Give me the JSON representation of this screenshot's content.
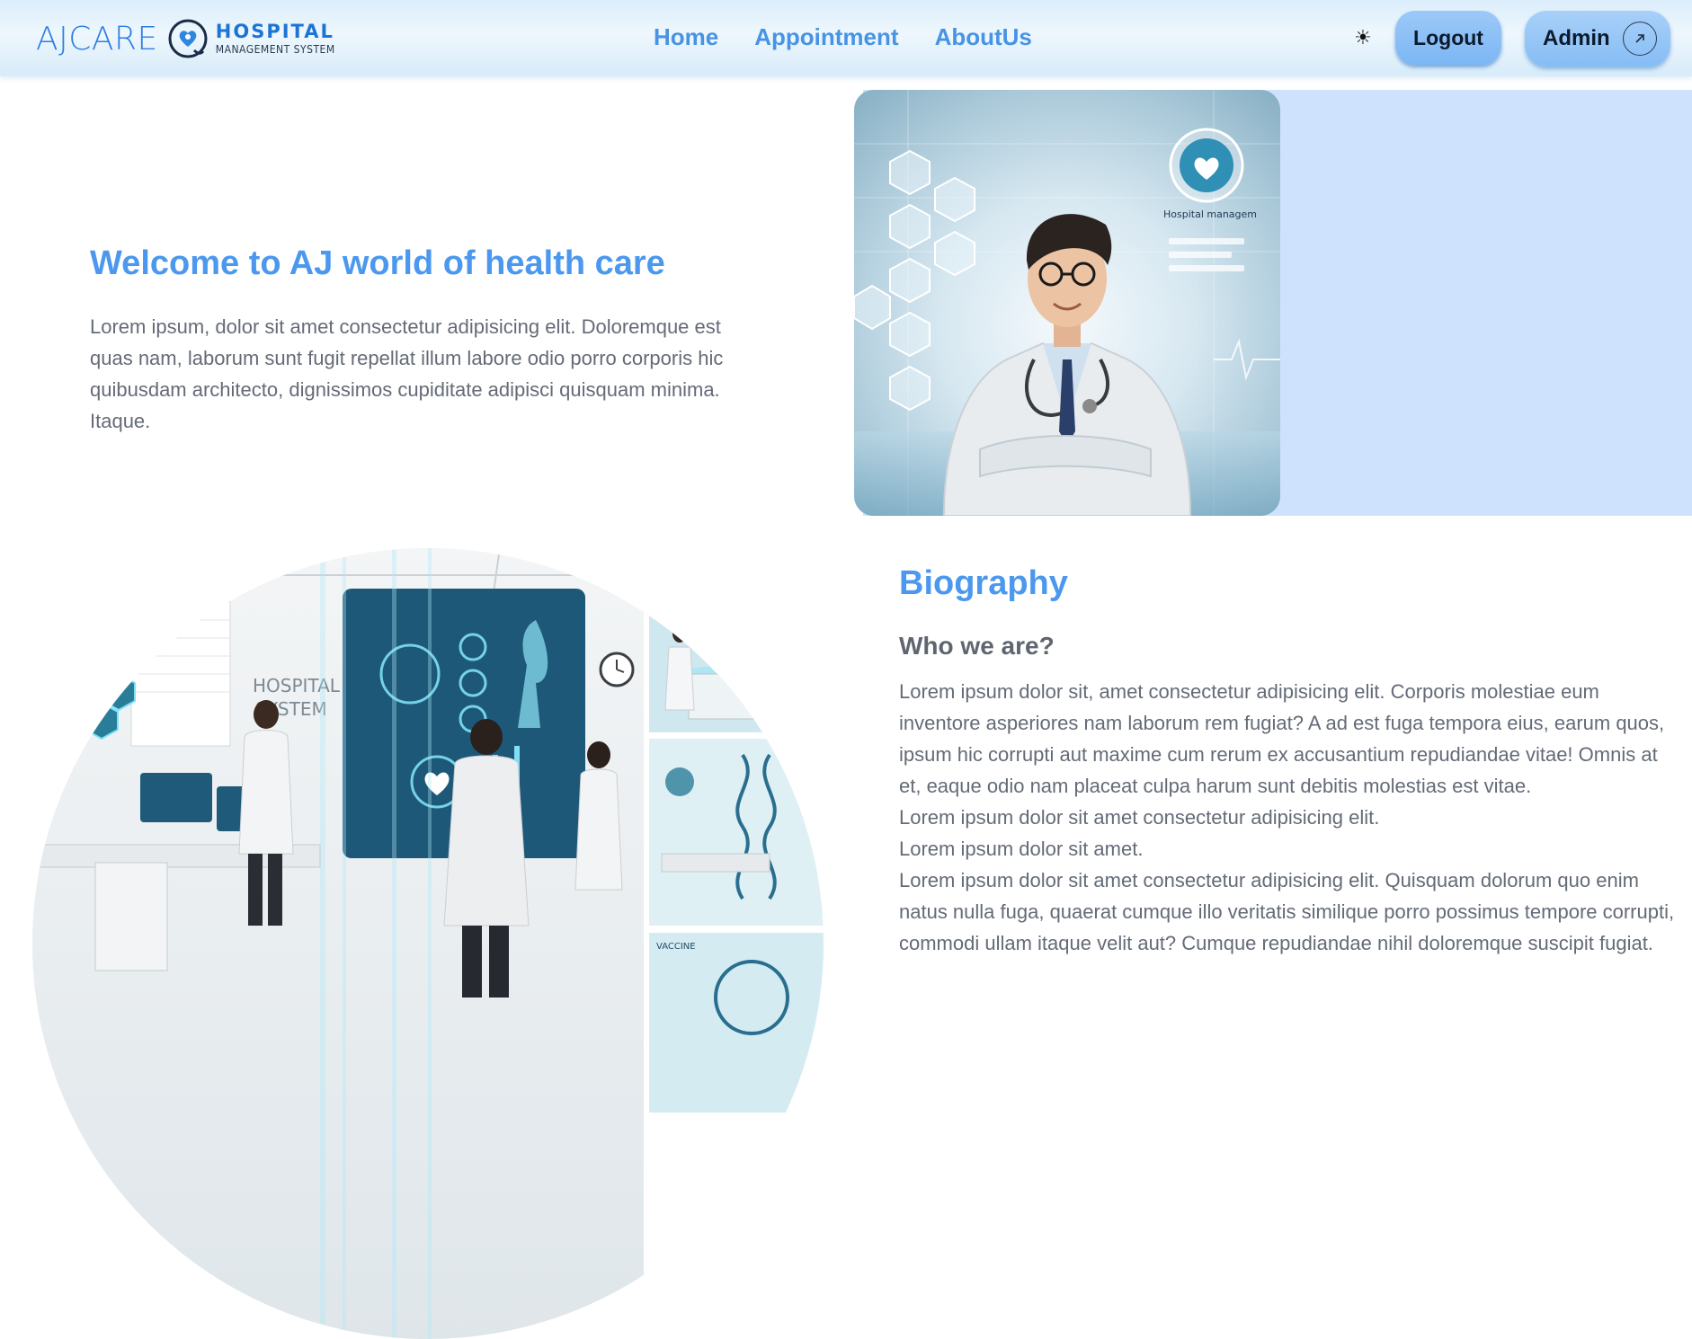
{
  "brand": {
    "name": "AJCARE",
    "sub_line_1": "HOSPITAL",
    "sub_line_2": "MANAGEMENT SYSTEM"
  },
  "nav": {
    "links": [
      "Home",
      "Appointment",
      "AboutUs"
    ],
    "theme_icon": "sun-icon",
    "logout_label": "Logout",
    "admin_label": "Admin",
    "admin_icon": "arrow-up-right-icon"
  },
  "hero": {
    "title": "Welcome to AJ world of health care",
    "text": "Lorem ipsum, dolor sit amet consectetur adipisicing elit. Doloremque est quas nam, laborum sunt fugit repellat illum labore odio porro corporis hic quibusdam architecto, dignissimos cupiditate adipisci quisquam minima. Itaque.",
    "image_panel_text": "Hospital managem"
  },
  "collage": {
    "wall_text_1": "HOSPITAL",
    "wall_text_2": "SYSTEM",
    "tile_label": "VACCINE"
  },
  "biography": {
    "title": "Biography",
    "subtitle": "Who we are?",
    "paragraphs": [
      "Lorem ipsum dolor sit, amet consectetur adipisicing elit. Corporis molestiae eum inventore asperiores nam laborum rem fugiat? A ad est fuga tempora eius, earum quos, ipsum hic corrupti aut maxime cum rerum ex accusantium repudiandae vitae! Omnis at et, eaque odio nam placeat culpa harum sunt debitis molestias est vitae.",
      "Lorem ipsum dolor sit amet consectetur adipisicing elit.",
      "Lorem ipsum dolor sit amet.",
      "Lorem ipsum dolor sit amet consectetur adipisicing elit. Quisquam dolorum quo enim natus nulla fuga, quaerat cumque illo veritatis similique porro possimus tempore corrupti, commodi ullam itaque velit aut? Cumque repudiandae nihil doloremque suscipit fugiat."
    ]
  },
  "colors": {
    "accent": "#4b98ee",
    "nav_link": "#4793e6",
    "button": "#86bdf5",
    "hero_panel": "#cfe2fd",
    "body_text": "#646b77"
  }
}
